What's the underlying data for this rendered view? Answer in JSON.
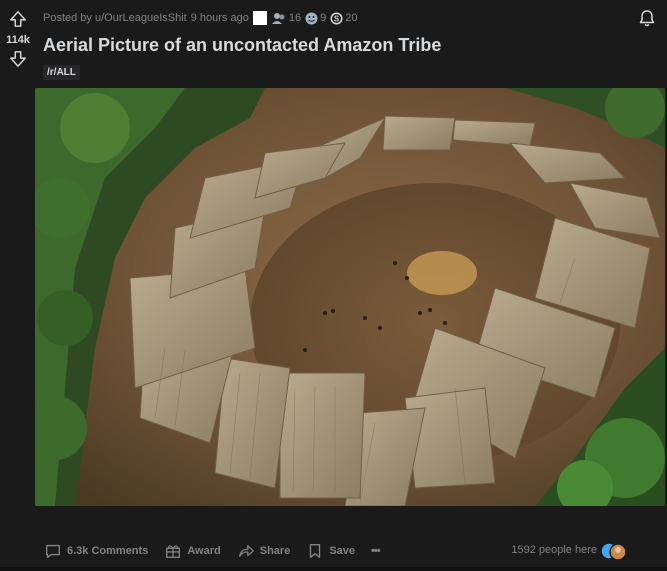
{
  "post": {
    "vote_count": "114k",
    "meta": {
      "posted_by": "Posted by u/OurLeagueIsShit",
      "time_ago": "9 hours ago",
      "award_counts": [
        "16",
        "9",
        "20"
      ]
    },
    "title": "Aerial Picture of an uncontacted Amazon Tribe",
    "flair": "/r/ALL"
  },
  "toolbar": {
    "comments_label": "6.3k Comments",
    "award_label": "Award",
    "share_label": "Share",
    "save_label": "Save",
    "more_label": "•••"
  },
  "presence": {
    "text": "1592 people here"
  },
  "colors": {
    "background": "#1a1a1b",
    "text_primary": "#d7dadc",
    "text_muted": "#818384",
    "flair_bg": "#272729"
  }
}
